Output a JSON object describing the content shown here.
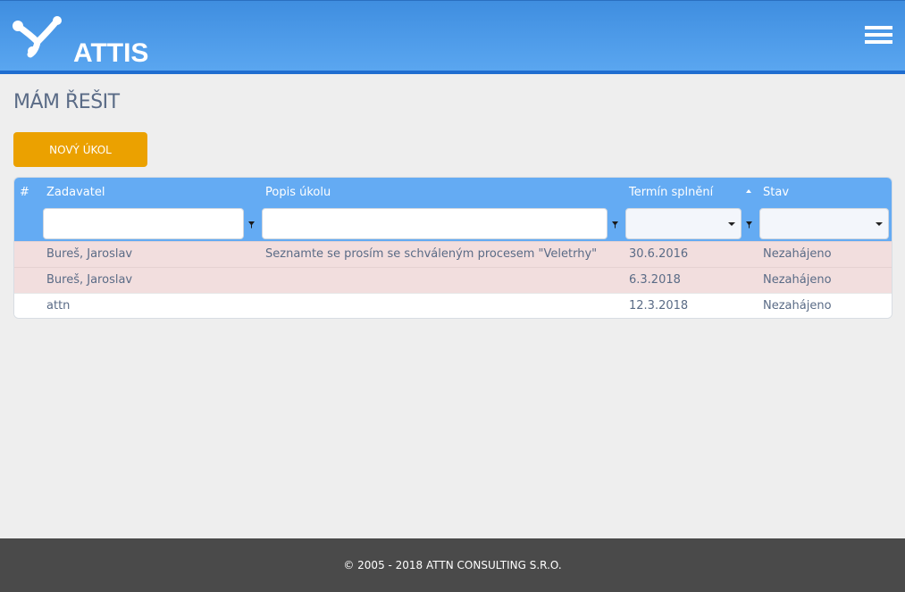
{
  "app": {
    "logo_text": "ATTIS",
    "menu_icon": "hamburger-icon",
    "brand_color": "#3f8ee0",
    "accent_color": "#eba100"
  },
  "page": {
    "title": "MÁM ŘEŠIT",
    "new_task_label": "NOVÝ ÚKOL"
  },
  "table": {
    "columns": {
      "index": "#",
      "submitter": "Zadavatel",
      "description": "Popis úkolu",
      "due_date": "Termín splnění",
      "status": "Stav"
    },
    "sort": {
      "column": "due_date",
      "direction": "asc"
    },
    "rows": [
      {
        "submitter": "Bureš, Jaroslav",
        "description": "Seznamte se prosím se schváleným procesem \"Veletrhy\"",
        "due_date": "30.6.2016",
        "status": "Nezahájeno",
        "highlight": "overdue"
      },
      {
        "submitter": "Bureš, Jaroslav",
        "description": "",
        "due_date": "6.3.2018",
        "status": "Nezahájeno",
        "highlight": "overdue"
      },
      {
        "submitter": "attn",
        "description": "",
        "due_date": "12.3.2018",
        "status": "Nezahájeno",
        "highlight": "none"
      }
    ]
  },
  "footer": {
    "copyright": "© 2005 - 2018 ATTN CONSULTING S.R.O."
  }
}
